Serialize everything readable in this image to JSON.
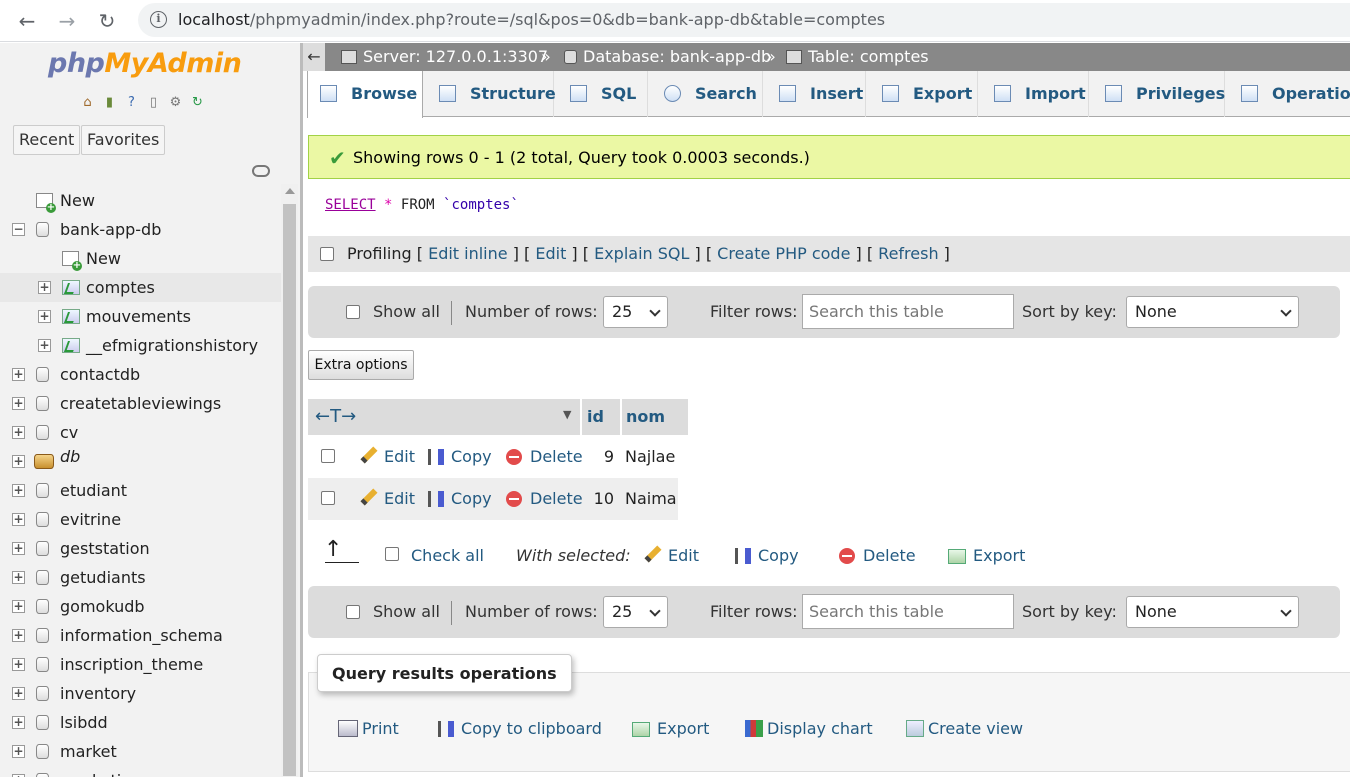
{
  "browser": {
    "url_host": "localhost",
    "url_rest": "/phpmyadmin/index.php?route=/sql&pos=0&db=bank-app-db&table=comptes"
  },
  "sidebar": {
    "logo_php": "php",
    "logo_rest": "MyAdmin",
    "recent_label": "Recent",
    "favorites_label": "Favorites",
    "tree": [
      {
        "label": "New",
        "type": "new",
        "level": 0
      },
      {
        "label": "bank-app-db",
        "type": "db",
        "level": 0,
        "expanded": true
      },
      {
        "label": "New",
        "type": "new",
        "level": 1
      },
      {
        "label": "comptes",
        "type": "table",
        "level": 1,
        "selected": true
      },
      {
        "label": "mouvements",
        "type": "table",
        "level": 1
      },
      {
        "label": "__efmigrationshistory",
        "type": "table",
        "level": 1
      },
      {
        "label": "contactdb",
        "type": "db",
        "level": 0
      },
      {
        "label": "createtableviewings",
        "type": "db",
        "level": 0
      },
      {
        "label": "cv",
        "type": "db",
        "level": 0
      },
      {
        "label": "db",
        "type": "db-special",
        "level": 0
      },
      {
        "label": "etudiant",
        "type": "db",
        "level": 0
      },
      {
        "label": "evitrine",
        "type": "db",
        "level": 0
      },
      {
        "label": "geststation",
        "type": "db",
        "level": 0
      },
      {
        "label": "getudiants",
        "type": "db",
        "level": 0
      },
      {
        "label": "gomokudb",
        "type": "db",
        "level": 0
      },
      {
        "label": "information_schema",
        "type": "db",
        "level": 0
      },
      {
        "label": "inscription_theme",
        "type": "db",
        "level": 0
      },
      {
        "label": "inventory",
        "type": "db",
        "level": 0
      },
      {
        "label": "lsibdd",
        "type": "db",
        "level": 0
      },
      {
        "label": "market",
        "type": "db",
        "level": 0
      },
      {
        "label": "marketipa",
        "type": "db",
        "level": 0
      }
    ]
  },
  "breadcrumb": {
    "server": "Server: 127.0.0.1:3307",
    "database": "Database: bank-app-db",
    "table": "Table: comptes",
    "sep": "»"
  },
  "tabs": [
    "Browse",
    "Structure",
    "SQL",
    "Search",
    "Insert",
    "Export",
    "Import",
    "Privileges",
    "Operation"
  ],
  "success_message": "Showing rows 0 - 1 (2 total, Query took 0.0003 seconds.)",
  "sql": {
    "select": "SELECT",
    "star": "*",
    "from": "FROM",
    "table": "`comptes`"
  },
  "profiling": {
    "label": "Profiling",
    "links": [
      "Edit inline",
      "Edit",
      "Explain SQL",
      "Create PHP code",
      "Refresh"
    ]
  },
  "navigation": {
    "show_all": "Show all",
    "num_rows_label": "Number of rows:",
    "num_rows_value": "25",
    "filter_label": "Filter rows:",
    "filter_placeholder": "Search this table",
    "sort_label": "Sort by key:",
    "sort_value": "None"
  },
  "extra_options": "Extra options",
  "results": {
    "columns": [
      "id",
      "nom"
    ],
    "actions": {
      "edit": "Edit",
      "copy": "Copy",
      "delete": "Delete"
    },
    "rows": [
      {
        "id": "9",
        "nom": "Najlae"
      },
      {
        "id": "10",
        "nom": "Naima"
      }
    ]
  },
  "with_selected": {
    "check_all": "Check all",
    "label": "With selected:",
    "edit": "Edit",
    "copy": "Copy",
    "delete": "Delete",
    "export": "Export"
  },
  "query_ops": {
    "title": "Query results operations",
    "print": "Print",
    "copy_clipboard": "Copy to clipboard",
    "export": "Export",
    "display_chart": "Display chart",
    "create_view": "Create view"
  },
  "colors": {
    "link": "#235a81",
    "success_bg": "#ebf8a4",
    "logo_php": "#6c78af",
    "logo_rest": "#f89c0e"
  }
}
